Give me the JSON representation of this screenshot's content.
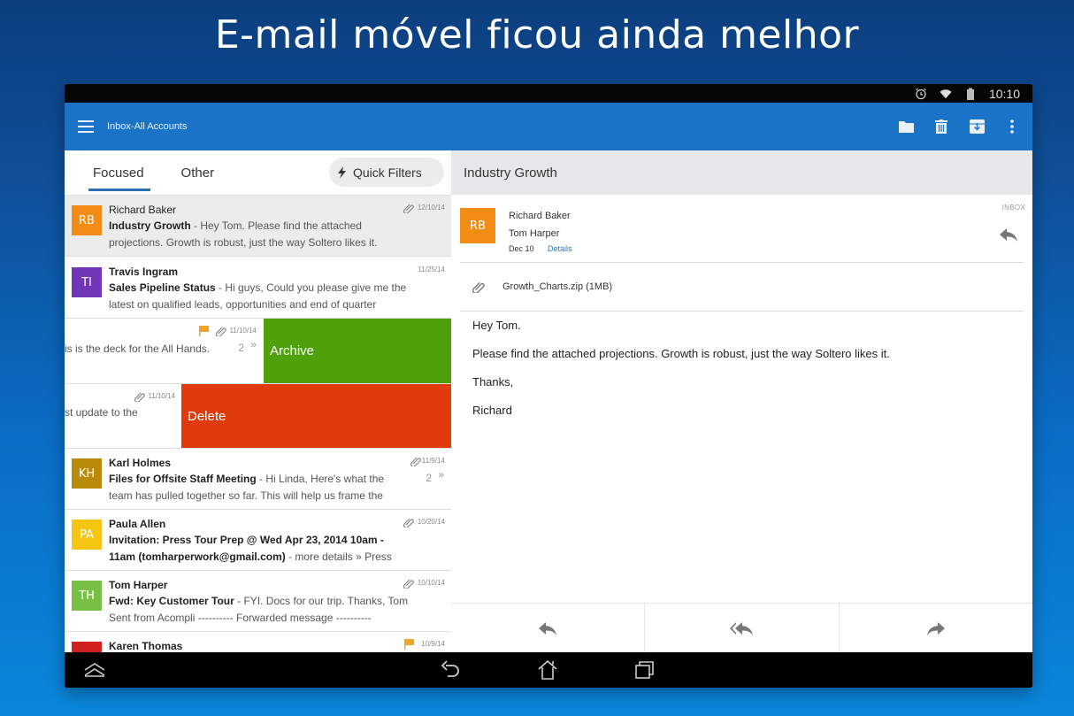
{
  "headline": "E-mail móvel ficou ainda melhor",
  "status_bar": {
    "time": "10:10",
    "icons": [
      "alarm-icon",
      "wifi-icon",
      "battery-icon"
    ]
  },
  "app_bar": {
    "title": "Inbox-All Accounts",
    "menu_icon": "hamburger-menu-icon",
    "actions": [
      "folder-icon",
      "trash-icon",
      "archive-icon",
      "more-vert-icon"
    ],
    "color": "#1a73c6"
  },
  "tabs": {
    "focused": "Focused",
    "other": "Other",
    "active": "Focused",
    "quick_filters": "Quick Filters"
  },
  "messages": [
    {
      "sender": "Richard Baker",
      "initials": "RB",
      "avatar_color": "#f28c14",
      "subject": "Industry Growth",
      "preview": " - Hey Tom. Please find the attached projections. Growth is robust, just the way Soltero likes it.",
      "date": "12/10/14",
      "attachment": true,
      "flag": false,
      "count": "",
      "selected": true
    },
    {
      "sender": "Travis Ingram",
      "initials": "TI",
      "avatar_color": "#7236b8",
      "subject": "Sales Pipeline Status",
      "preview": " - Hi guys, Could you please give me the latest on qualified leads, opportunities and end of quarter",
      "date": "11/25/14",
      "attachment": false,
      "flag": false,
      "count": ""
    },
    {
      "partial_preview": "is is the deck for the All Hands.",
      "date": "11/10/14",
      "attachment": true,
      "flag": true,
      "count": "2",
      "swipe_action": "Archive",
      "swipe_color": "#4ea10a"
    },
    {
      "partial_preview": "st update to the",
      "date": "11/10/14",
      "attachment": true,
      "flag": false,
      "swipe_action": "Delete",
      "swipe_color": "#e03a0d"
    },
    {
      "sender": "Karl Holmes",
      "initials": "KH",
      "avatar_color": "#b88a0a",
      "subject": "Files for Offsite Staff Meeting",
      "preview": " - Hi Linda, Here's what the team has pulled together so far. This will help us frame the",
      "date": "11/9/14",
      "attachment": true,
      "flag": false,
      "count": "2"
    },
    {
      "sender": "Paula Allen",
      "initials": "PA",
      "avatar_color": "#f5c511",
      "subject": "Invitation: Press Tour Prep @ Wed Apr 23, 2014 10am - 11am (tomharperwork@gmail.com)",
      "preview": " - more details » Press",
      "date": "10/20/14",
      "attachment": true,
      "flag": false,
      "count": ""
    },
    {
      "sender": "Tom Harper",
      "initials": "TH",
      "avatar_color": "#77c043",
      "subject": "Fwd: Key Customer Tour",
      "preview": " - FYI. Docs for our trip. Thanks, Tom Sent from Acompli ---------- Forwarded message ----------",
      "date": "10/10/14",
      "attachment": true,
      "flag": false,
      "count": ""
    },
    {
      "sender": "Karen Thomas",
      "initials": "",
      "avatar_color": "#d01f1f",
      "subject": "",
      "preview": "",
      "date": "10/9/14",
      "attachment": false,
      "flag": true,
      "count": ""
    }
  ],
  "reading_pane": {
    "subject": "Industry Growth",
    "from": "Richard Baker",
    "to": "Tom Harper",
    "initials": "RB",
    "avatar_color": "#f28c14",
    "date": "Dec 10",
    "details_link": "Details",
    "folder": "INBOX",
    "attachment": "Growth_Charts.zip (1MB)",
    "body": [
      "Hey Tom.",
      "Please find the attached projections. Growth is robust, just the way Soltero likes it.",
      "Thanks,",
      "Richard"
    ],
    "actions": [
      "reply-icon",
      "reply-all-icon",
      "forward-icon"
    ]
  },
  "nav_bar": {
    "buttons": [
      "expand-up-icon",
      "back-icon",
      "home-icon",
      "recents-icon"
    ]
  },
  "colors": {
    "flag": "#f0a526",
    "link": "#2f73b5"
  }
}
